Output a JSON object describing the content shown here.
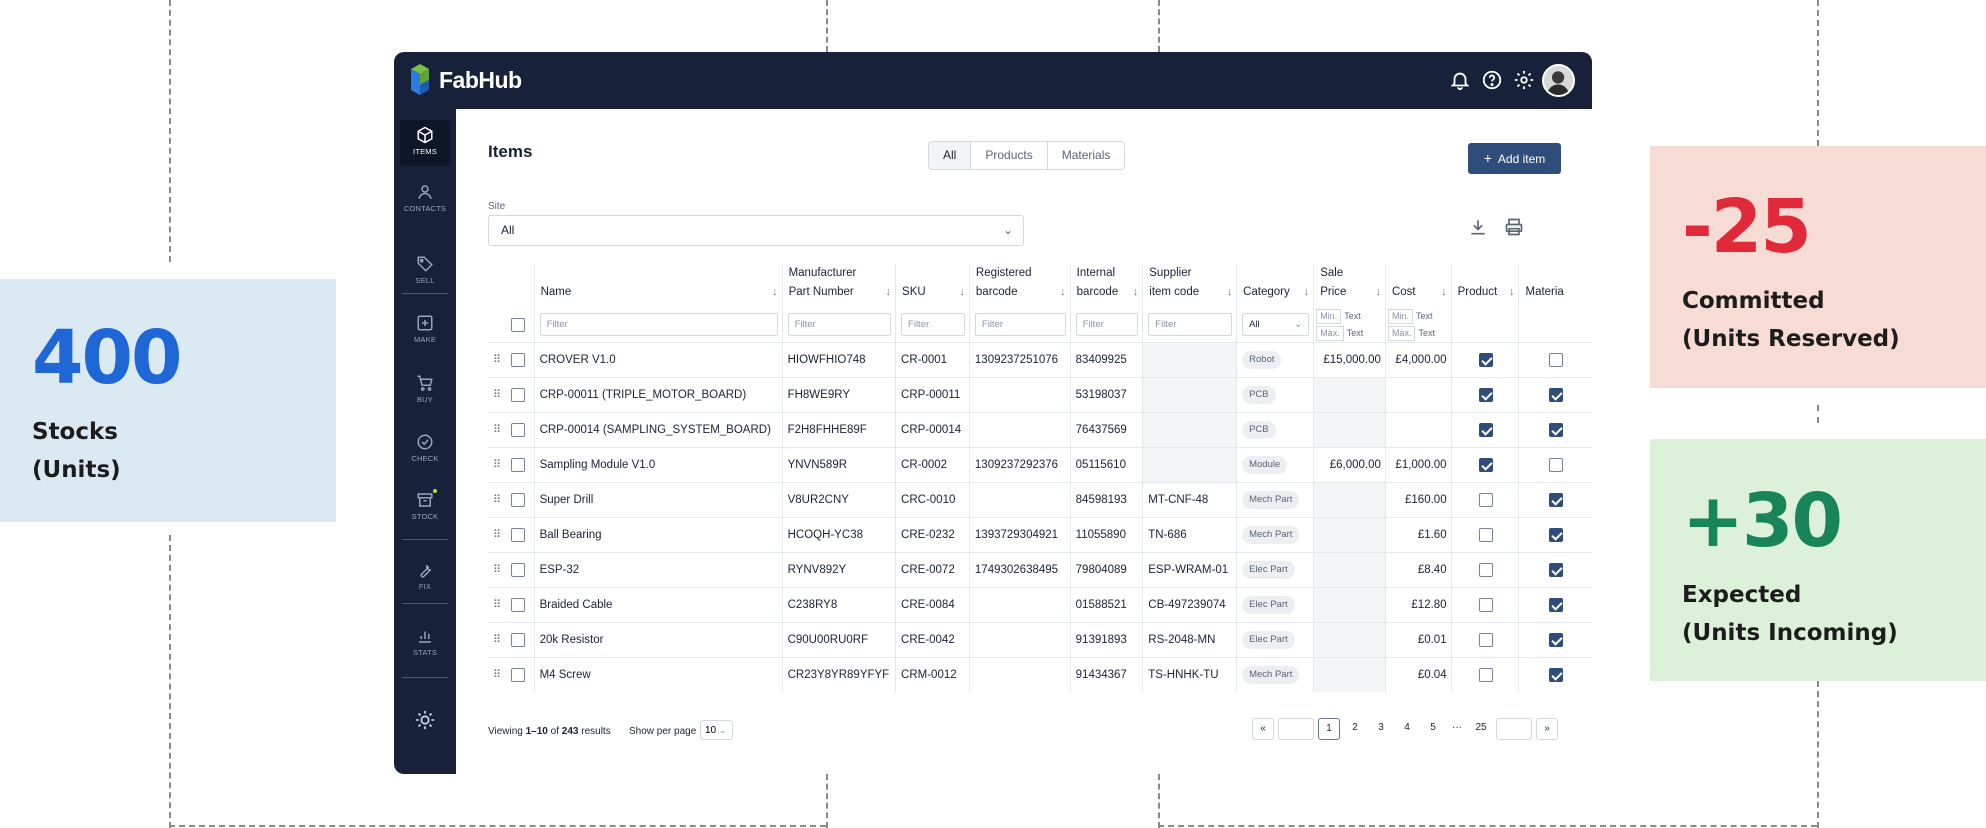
{
  "stats": {
    "stock": {
      "value": "400",
      "label_line1": "Stocks",
      "label_line2": "(Units)"
    },
    "committed": {
      "value": "-25",
      "label_line1": "Committed",
      "label_line2": "(Units Reserved)"
    },
    "expected": {
      "value": "+30",
      "label_line1": "Expected",
      "label_line2": "(Units Incoming)"
    }
  },
  "brand": {
    "name": "FabHub",
    "colors": {
      "navy": "#17223a",
      "accent": "#2f4d7a",
      "logo_green": "#7ac143",
      "logo_blue": "#2c7be5"
    }
  },
  "topbar": {
    "icons": [
      "bell-icon",
      "help-icon",
      "settings-icon"
    ]
  },
  "sidebar": {
    "items": [
      {
        "label": "ITEMS",
        "icon": "box-icon",
        "active": true
      },
      {
        "label": "CONTACTS",
        "icon": "person-icon"
      },
      {
        "label": "SELL",
        "icon": "tag-icon"
      },
      {
        "label": "MAKE",
        "icon": "plus-square-icon"
      },
      {
        "label": "BUY",
        "icon": "cart-icon"
      },
      {
        "label": "CHECK",
        "icon": "check-circle-icon"
      },
      {
        "label": "STOCK",
        "icon": "archive-icon"
      },
      {
        "label": "FIX",
        "icon": "wrench-icon"
      },
      {
        "label": "STATS",
        "icon": "bar-chart-icon"
      }
    ],
    "theme_icon": "sun-icon"
  },
  "main": {
    "title": "Items",
    "tabs": [
      {
        "label": "All"
      },
      {
        "label": "Products"
      },
      {
        "label": "Materials"
      }
    ],
    "add_button": "Add item",
    "site": {
      "label": "Site",
      "value": "All"
    }
  },
  "table": {
    "columns": [
      {
        "line1": "",
        "line2": "Name"
      },
      {
        "line1": "Manufacturer",
        "line2": "Part Number"
      },
      {
        "line1": "",
        "line2": "SKU"
      },
      {
        "line1": "Registered",
        "line2": "barcode"
      },
      {
        "line1": "Internal",
        "line2": "barcode"
      },
      {
        "line1": "Supplier",
        "line2": "item code"
      },
      {
        "line1": "",
        "line2": "Category"
      },
      {
        "line1": "Sale",
        "line2": "Price"
      },
      {
        "line1": "",
        "line2": "Cost"
      },
      {
        "line1": "",
        "line2": "Product"
      },
      {
        "line1": "",
        "line2": "Materia"
      }
    ],
    "filter_placeholder": "Filter",
    "category_filter": "All",
    "price_min": "Min.",
    "price_max": "Max.",
    "price_text": "Text",
    "rows": [
      {
        "name": "CROVER V1.0",
        "mpn": "HIOWFHIO748",
        "sku": "CR-0001",
        "reg": "1309237251076",
        "int": "83409925",
        "sup": "",
        "cat": "Robot",
        "sale": "£15,000.00",
        "cost": "£4,000.00",
        "product": true,
        "material": false
      },
      {
        "name": "CRP-00011 (TRIPLE_MOTOR_BOARD)",
        "mpn": "FH8WE9RY",
        "sku": "CRP-00011",
        "reg": "",
        "int": "53198037",
        "sup": "",
        "cat": "PCB",
        "sale": "",
        "cost": "",
        "product": true,
        "material": true
      },
      {
        "name": "CRP-00014 (SAMPLING_SYSTEM_BOARD)",
        "mpn": "F2H8FHHE89F",
        "sku": "CRP-00014",
        "reg": "",
        "int": "76437569",
        "sup": "",
        "cat": "PCB",
        "sale": "",
        "cost": "",
        "product": true,
        "material": true
      },
      {
        "name": "Sampling Module V1.0",
        "mpn": "YNVN589R",
        "sku": "CR-0002",
        "reg": "1309237292376",
        "int": "05115610",
        "sup": "",
        "cat": "Module",
        "sale": "£6,000.00",
        "cost": "£1,000.00",
        "product": true,
        "material": false
      },
      {
        "name": "Super Drill",
        "mpn": "V8UR2CNY",
        "sku": "CRC-0010",
        "reg": "",
        "int": "84598193",
        "sup": "MT-CNF-48",
        "cat": "Mech Part",
        "sale": "",
        "cost": "£160.00",
        "product": false,
        "material": true
      },
      {
        "name": "Ball Bearing",
        "mpn": "HCOQH-YC38",
        "sku": "CRE-0232",
        "reg": "1393729304921",
        "int": "11055890",
        "sup": "TN-686",
        "cat": "Mech Part",
        "sale": "",
        "cost": "£1.60",
        "product": false,
        "material": true
      },
      {
        "name": "ESP-32",
        "mpn": "RYNV892Y",
        "sku": "CRE-0072",
        "reg": "1749302638495",
        "int": "79804089",
        "sup": "ESP-WRAM-01",
        "cat": "Elec Part",
        "sale": "",
        "cost": "£8.40",
        "product": false,
        "material": true
      },
      {
        "name": "Braided Cable",
        "mpn": "C238RY8",
        "sku": "CRE-0084",
        "reg": "",
        "int": "01588521",
        "sup": "CB-497239074",
        "cat": "Elec Part",
        "sale": "",
        "cost": "£12.80",
        "product": false,
        "material": true
      },
      {
        "name": "20k Resistor",
        "mpn": "C90U00RU0RF",
        "sku": "CRE-0042",
        "reg": "",
        "int": "91391893",
        "sup": "RS-2048-MN",
        "cat": "Elec Part",
        "sale": "",
        "cost": "£0.01",
        "product": false,
        "material": true
      },
      {
        "name": "M4 Screw",
        "mpn": "CR23Y8YR89YFYF",
        "sku": "CRM-0012",
        "reg": "",
        "int": "91434367",
        "sup": "TS-HNHK-TU",
        "cat": "Mech Part",
        "sale": "",
        "cost": "£0.04",
        "product": false,
        "material": true
      }
    ]
  },
  "footer": {
    "viewing_prefix": "Viewing",
    "range": "1–10",
    "of": "of",
    "total": "243",
    "results": "results",
    "per_page_label": "Show per page",
    "per_page_value": "10",
    "pages": [
      "1",
      "2",
      "3",
      "4",
      "5"
    ],
    "ellipsis": "···",
    "last_page": "25",
    "first_icon": "«",
    "next_icon": "»"
  }
}
